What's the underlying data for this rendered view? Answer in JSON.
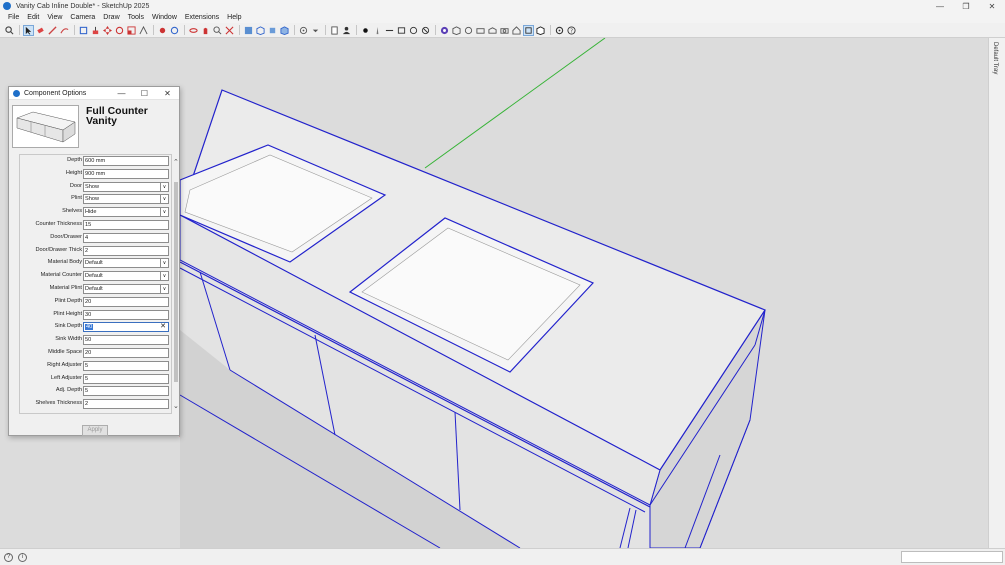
{
  "window": {
    "title": "Vanity Cab Inline Double* - SketchUp 2025"
  },
  "menu": [
    "File",
    "Edit",
    "View",
    "Camera",
    "Draw",
    "Tools",
    "Window",
    "Extensions",
    "Help"
  ],
  "toolbar_icons": [
    "search-icon",
    "select-icon",
    "eraser-icon",
    "pencil-icon",
    "line-icon",
    "shape-icon",
    "push-pull-icon",
    "move-icon",
    "rotate-icon",
    "scale-icon",
    "offset-icon",
    "tape-icon",
    "text-icon",
    "axes-icon",
    "orbit-icon",
    "pan-icon",
    "zoom-icon",
    "zoom-extents-icon",
    "section-icon",
    "box-icon",
    "dot-icon",
    "sun-icon",
    "rect-icon",
    "cylinder-icon",
    "no-icon",
    "help-icon"
  ],
  "tray": {
    "label": "Default Tray"
  },
  "dialog": {
    "title": "Component Options",
    "component_name": "Full Counter Vanity",
    "apply_label": "Apply",
    "fields": [
      {
        "label": "Depth",
        "value": "600 mm",
        "kind": "input"
      },
      {
        "label": "Height",
        "value": "900 mm",
        "kind": "input"
      },
      {
        "label": "Door",
        "value": "Show",
        "kind": "select"
      },
      {
        "label": "Plint",
        "value": "Show",
        "kind": "select"
      },
      {
        "label": "Shelves",
        "value": "Hide",
        "kind": "select"
      },
      {
        "label": "Counter Thickness",
        "value": "15",
        "kind": "input"
      },
      {
        "label": "Door/Drawer",
        "value": "4",
        "kind": "input"
      },
      {
        "label": "Door/Drawer Thick",
        "value": "2",
        "kind": "input"
      },
      {
        "label": "Material Body",
        "value": "Default",
        "kind": "select"
      },
      {
        "label": "Material Counter",
        "value": "Default",
        "kind": "select"
      },
      {
        "label": "Material Plint",
        "value": "Default",
        "kind": "select"
      },
      {
        "label": "Plint Depth",
        "value": "20",
        "kind": "input"
      },
      {
        "label": "Plint Height",
        "value": "30",
        "kind": "input"
      },
      {
        "label": "Sink Depth",
        "value": "40",
        "kind": "input-focused"
      },
      {
        "label": "Sink Width",
        "value": "50",
        "kind": "input"
      },
      {
        "label": "Middle Space",
        "value": "20",
        "kind": "input"
      },
      {
        "label": "Right Adjuster",
        "value": "5",
        "kind": "input"
      },
      {
        "label": "Left Adjuster",
        "value": "5",
        "kind": "input"
      },
      {
        "label": "Adj. Depth",
        "value": "5",
        "kind": "input"
      },
      {
        "label": "Shelves Thickness",
        "value": "2",
        "kind": "input"
      }
    ]
  },
  "colors": {
    "edge": "#2222cc",
    "accent": "#1e6fc9",
    "green_axis": "#36b336",
    "red_axis": "#c84040"
  }
}
